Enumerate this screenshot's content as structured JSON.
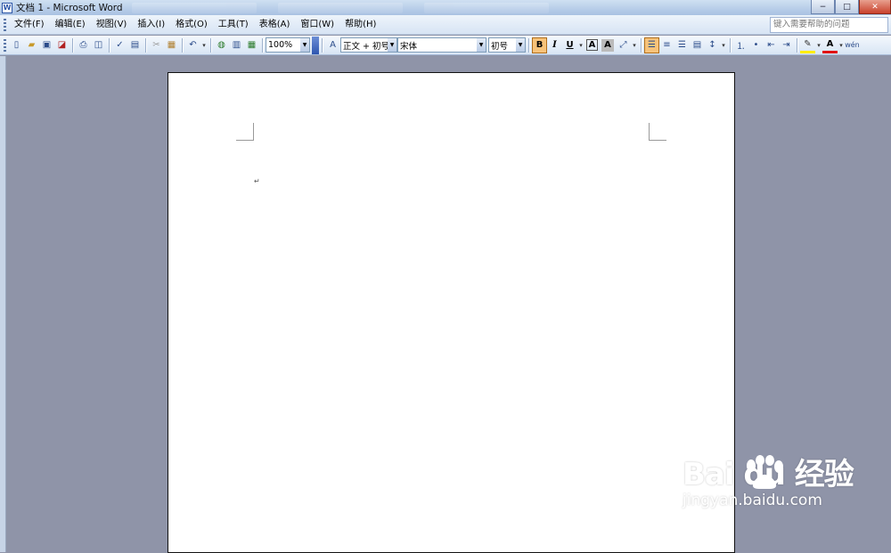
{
  "window": {
    "title": "文档 1 - Microsoft Word",
    "app_icon": "W",
    "controls": {
      "minimize": "−",
      "maximize": "□",
      "close": "✕"
    }
  },
  "menu": {
    "items": [
      "文件(F)",
      "编辑(E)",
      "视图(V)",
      "插入(I)",
      "格式(O)",
      "工具(T)",
      "表格(A)",
      "窗口(W)",
      "帮助(H)"
    ],
    "help_placeholder": "键入需要帮助的问题"
  },
  "toolbar": {
    "zoom": "100%",
    "style": "正文 + 初号",
    "font": "宋体",
    "font_size": "初号",
    "bold_label": "B",
    "italic_label": "I",
    "underline_label": "U",
    "char_border_label": "A",
    "char_shading_label": "A",
    "phonetic_label": "wén",
    "font_color_label": "A",
    "style_icon": "styles-icon"
  },
  "document": {
    "paragraph_mark": "↵"
  },
  "watermark": {
    "logo": "Bai du 经验",
    "url": "jingyan.baidu.com"
  },
  "colors": {
    "workspace": "#8f94a8",
    "toolbar_active": "#f7c37a",
    "close_button": "#c9412b"
  }
}
